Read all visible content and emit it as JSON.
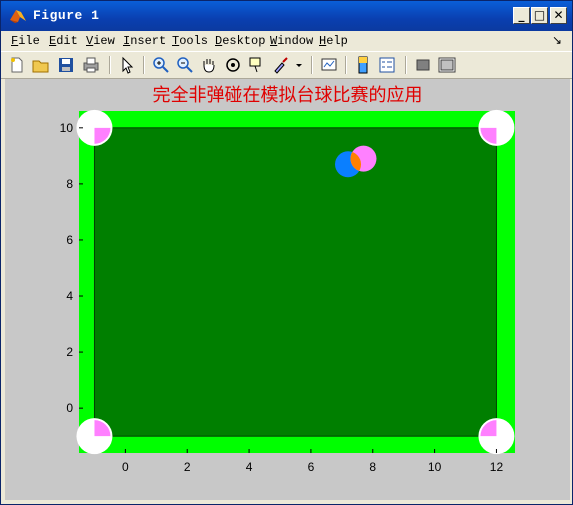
{
  "window": {
    "title": "Figure 1"
  },
  "menu": {
    "items": [
      {
        "label": "File",
        "key": "F",
        "rest": "ile"
      },
      {
        "label": "Edit",
        "key": "E",
        "rest": "dit"
      },
      {
        "label": "View",
        "key": "V",
        "rest": "iew"
      },
      {
        "label": "Insert",
        "key": "I",
        "rest": "nsert"
      },
      {
        "label": "Tools",
        "key": "T",
        "rest": "ools"
      },
      {
        "label": "Desktop",
        "key": "D",
        "rest": "esktop"
      },
      {
        "label": "Window",
        "key": "W",
        "rest": "indow"
      },
      {
        "label": "Help",
        "key": "H",
        "rest": "elp"
      }
    ],
    "dock_glyph": "↘"
  },
  "toolbar": {
    "icons": [
      "new-figure-icon",
      "open-file-icon",
      "save-icon",
      "print-icon",
      "edit-plot-arrow-icon",
      "zoom-in-icon",
      "zoom-out-icon",
      "pan-hand-icon",
      "rotate-3d-icon",
      "data-cursor-icon",
      "brush-icon",
      "brush-dropdown-icon",
      "link-plot-icon",
      "insert-colorbar-icon",
      "insert-legend-icon",
      "hide-plot-tools-icon",
      "show-plot-tools-icon"
    ]
  },
  "chart_data": {
    "type": "scatter",
    "title": "完全非弹碰在模拟台球比赛的应用",
    "xticks": [
      "0",
      "2",
      "4",
      "6",
      "8",
      "10",
      "12"
    ],
    "yticks": [
      "0",
      "2",
      "4",
      "6",
      "8",
      "10"
    ],
    "xlim": [
      -1.5,
      12.6
    ],
    "ylim": [
      -1.6,
      10.6
    ],
    "table": {
      "x": [
        -1,
        12
      ],
      "y": [
        -1,
        10
      ],
      "color": "#007f00",
      "cushion_color": "#00ff00"
    },
    "pockets": [
      {
        "x": -1,
        "y": 10
      },
      {
        "x": 12,
        "y": 10
      },
      {
        "x": -1,
        "y": -1
      },
      {
        "x": 12,
        "y": -1
      }
    ],
    "balls": [
      {
        "x": 7.2,
        "y": 8.7,
        "color": "#0a7fff"
      },
      {
        "x": 7.7,
        "y": 8.9,
        "color": "#ff80ff"
      }
    ],
    "overlap_color": "#ff8000",
    "pocket_color": "#ffffff",
    "pocket_corner_color": "#ff80ff"
  }
}
